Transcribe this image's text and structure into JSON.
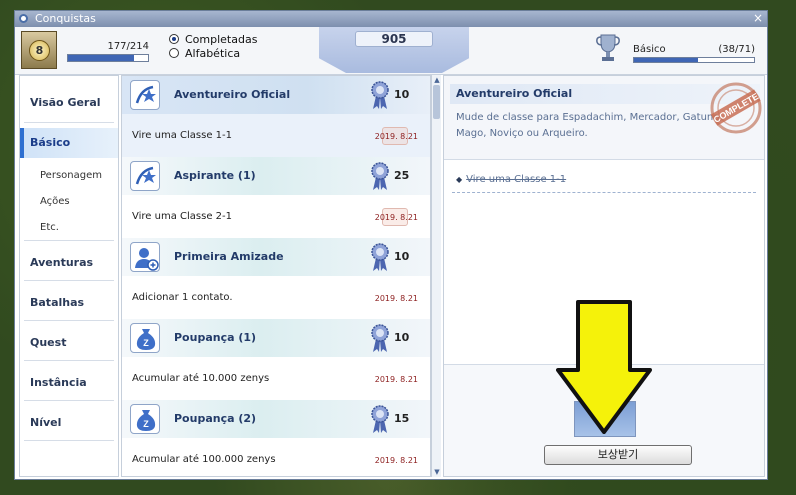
{
  "window": {
    "title": "Conquistas",
    "close": "×"
  },
  "header": {
    "level": "8",
    "xp": "177/214",
    "xp_fraction": 0.83,
    "sort_options": [
      {
        "label": "Completadas",
        "selected": true
      },
      {
        "label": "Alfabética",
        "selected": false
      }
    ],
    "score": "905",
    "rank_label": "Básico",
    "rank_count": "(38/71)",
    "rank_fraction": 0.535
  },
  "sidebar": {
    "items": [
      {
        "label": "Visão Geral",
        "active": false
      },
      {
        "label": "Básico",
        "active": true
      },
      {
        "label": "Aventuras",
        "active": false
      },
      {
        "label": "Batalhas",
        "active": false
      },
      {
        "label": "Quest",
        "active": false
      },
      {
        "label": "Instância",
        "active": false
      },
      {
        "label": "Nível",
        "active": false
      }
    ],
    "subitems": [
      "Personagem",
      "Ações",
      "Etc."
    ]
  },
  "list": {
    "items": [
      {
        "title": "Aventureiro Oficial",
        "points": "10",
        "desc": "Vire uma Classe 1-1",
        "date": "2019. 8.21",
        "icon": "star-swoosh-icon",
        "selected": true
      },
      {
        "title": "Aspirante (1)",
        "points": "25",
        "desc": "Vire uma Classe 2-1",
        "date": "2019. 8.21",
        "icon": "star-swoosh-icon",
        "selected": false
      },
      {
        "title": "Primeira Amizade",
        "points": "10",
        "desc": "Adicionar 1 contato.",
        "date": "2019. 8.21",
        "icon": "add-person-icon",
        "selected": false
      },
      {
        "title": "Poupança (1)",
        "points": "10",
        "desc": "Acumular até 10.000 zenys",
        "date": "2019. 8.21",
        "icon": "money-bag-icon",
        "selected": false
      },
      {
        "title": "Poupança (2)",
        "points": "15",
        "desc": "Acumular até 100.000 zenys",
        "date": "2019. 8.21",
        "icon": "money-bag-icon",
        "selected": false
      }
    ]
  },
  "detail": {
    "title": "Aventureiro Oficial",
    "description": "Mude de classe para Espadachim, Mercador, Gatuno, Mago, Noviço ou Arqueiro.",
    "stamp_text": "COMPLETE",
    "goal": "Vire uma Classe 1-1",
    "claim_button": "보상받기"
  },
  "colors": {
    "accent": "#3f66b5",
    "arrow": "#f5f20a",
    "date": "#8c1d1d"
  }
}
